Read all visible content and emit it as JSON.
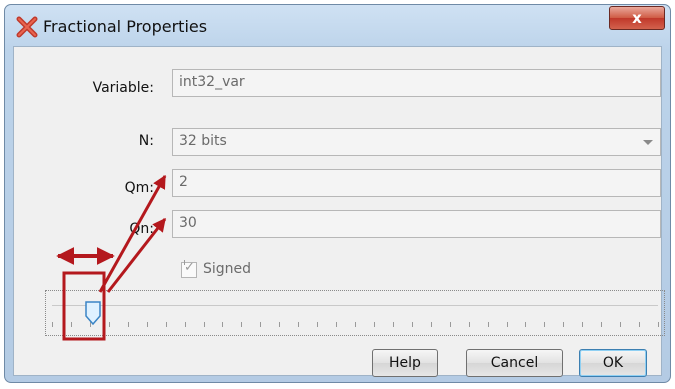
{
  "window": {
    "title": "Fractional Properties",
    "close_label": "x"
  },
  "form": {
    "variable": {
      "label": "Variable:",
      "value": "int32_var"
    },
    "n": {
      "label": "N:",
      "value": "32 bits"
    },
    "qm": {
      "label": "Qm:",
      "value": "2"
    },
    "qn": {
      "label": "Qn:",
      "value": "30"
    },
    "signed": {
      "label": "Signed",
      "checked": true
    }
  },
  "slider": {
    "value": 2,
    "min": 0,
    "max": 32,
    "tick_count": 32
  },
  "buttons": {
    "help": "Help",
    "cancel": "Cancel",
    "ok": "OK"
  },
  "annotation_color": "#b4181d",
  "icons": [
    "app-x-icon",
    "close-icon",
    "combo-arrow-icon",
    "checkmark-icon",
    "slider-thumb-icon"
  ]
}
